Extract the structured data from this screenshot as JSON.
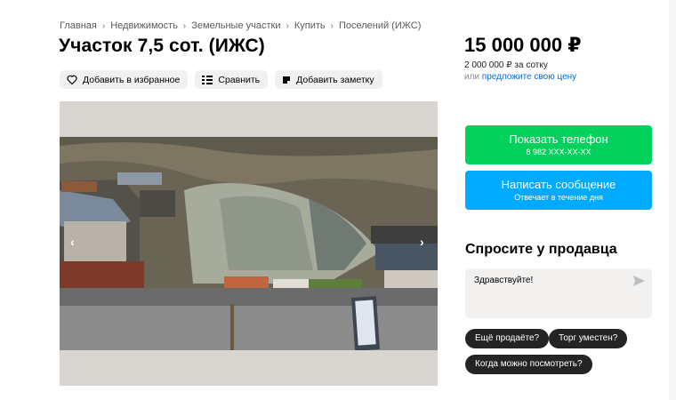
{
  "breadcrumb": [
    "Главная",
    "Недвижимость",
    "Земельные участки",
    "Купить",
    "Поселений (ИЖС)"
  ],
  "title": "Участок 7,5 сот. (ИЖС)",
  "actions": {
    "favorite_label": "Добавить в избранное",
    "compare_label": "Сравнить",
    "note_label": "Добавить заметку"
  },
  "price": {
    "total": "15 000 000 ₽",
    "per_unit": "2 000 000 ₽ за сотку",
    "offer_prefix": "или",
    "offer_link": "предложите свою цену"
  },
  "contact": {
    "phone_label": "Показать телефон",
    "phone_masked": "8 982 XXX-XX-XX",
    "message_label": "Написать сообщение",
    "message_sub": "Отвечает в течение дня"
  },
  "ask": {
    "title": "Спросите у продавца",
    "text": "Здравствуйте!",
    "chips": [
      "Ещё продаёте?",
      "Торг уместен?",
      "Когда можно посмотреть?"
    ]
  },
  "gallery": {
    "prev_arrow": "‹",
    "next_arrow": "›"
  },
  "colors": {
    "phone_button": "#02d15c",
    "message_button": "#00aaff",
    "link": "#0a6bd6",
    "chip": "#242424"
  }
}
